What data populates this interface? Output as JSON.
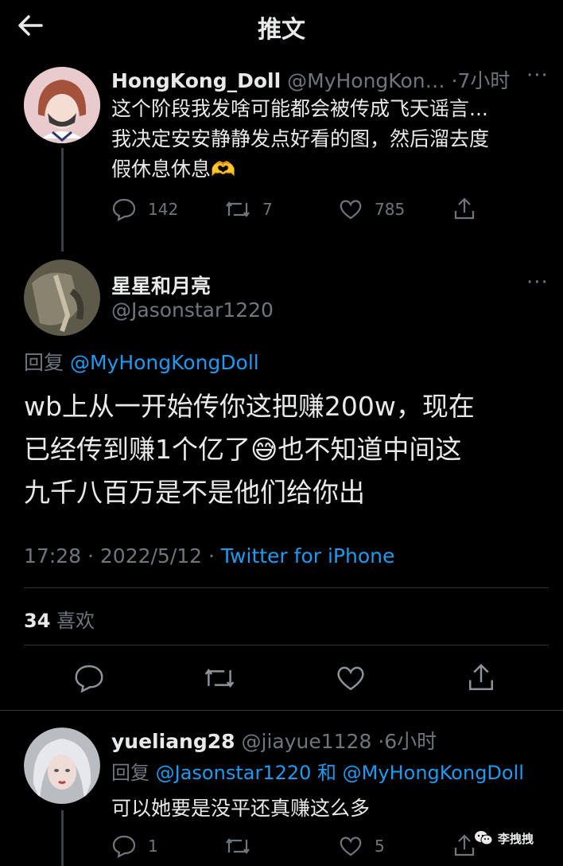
{
  "header": {
    "title": "推文"
  },
  "tweet1": {
    "name": "HongKong_Doll",
    "handle": "@MyHongKon…",
    "time": "·7小时",
    "text_line1": "这个阶段我发啥可能都会被传成飞天谣言...",
    "text_line2": "我决定安安静静发点好看的图，然后溜去度",
    "text_line3": "假休息休息🫶",
    "replies": "142",
    "retweets": "7",
    "likes": "785"
  },
  "main_tweet": {
    "name": "星星和月亮",
    "handle": "@Jasonstar1220",
    "reply_prefix": "回复",
    "reply_to": "@MyHongKongDoll",
    "text_line1": "wb上从一开始传你这把赚200w，现在",
    "text_line2": "已经传到赚1个亿了😅也不知道中间这",
    "text_line3": "九千八百万是不是他们给你出",
    "timestamp": "17:28 · 2022/5/12 · ",
    "source": "Twitter for iPhone",
    "likes_count": "34",
    "likes_label": "喜欢"
  },
  "tweet3": {
    "name": "yueliang28",
    "handle": "@jiayue1128",
    "time": "·6小时",
    "reply_prefix": "回复",
    "reply_to_1": "@Jasonstar1220",
    "and": "和",
    "reply_to_2": "@MyHongKongDoll",
    "text": "可以她要是没平还真赚这么多",
    "replies": "1",
    "likes": "5"
  },
  "watermark": {
    "text": "李拽拽"
  }
}
